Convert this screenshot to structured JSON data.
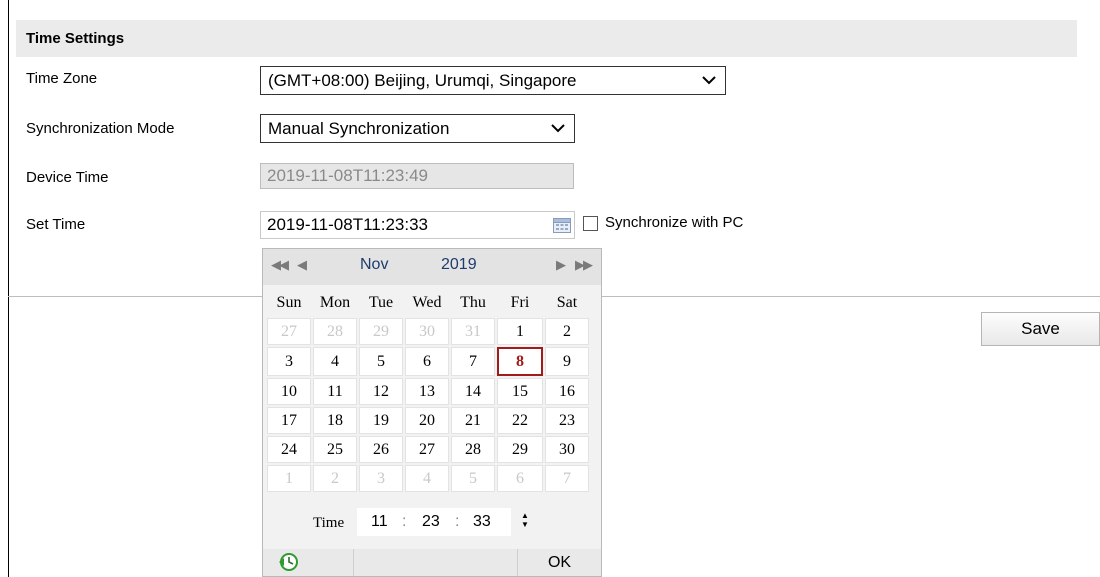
{
  "section": {
    "title": "Time Settings"
  },
  "fields": {
    "time_zone_label": "Time Zone",
    "time_zone_value": "(GMT+08:00) Beijing, Urumqi, Singapore",
    "sync_mode_label": "Synchronization Mode",
    "sync_mode_value": "Manual Synchronization",
    "device_time_label": "Device Time",
    "device_time_value": "2019-11-08T11:23:49",
    "set_time_label": "Set Time",
    "set_time_value": "2019-11-08T11:23:33",
    "sync_pc_label": "Synchronize with PC",
    "sync_pc_checked": false
  },
  "buttons": {
    "save": "Save",
    "ok": "OK"
  },
  "calendar": {
    "month": "Nov",
    "year": "2019",
    "weekdays": [
      "Sun",
      "Mon",
      "Tue",
      "Wed",
      "Thu",
      "Fri",
      "Sat"
    ],
    "weeks": [
      [
        "27",
        "28",
        "29",
        "30",
        "31",
        "1",
        "2"
      ],
      [
        "3",
        "4",
        "5",
        "6",
        "7",
        "8",
        "9"
      ],
      [
        "10",
        "11",
        "12",
        "13",
        "14",
        "15",
        "16"
      ],
      [
        "17",
        "18",
        "19",
        "20",
        "21",
        "22",
        "23"
      ],
      [
        "24",
        "25",
        "26",
        "27",
        "28",
        "29",
        "30"
      ],
      [
        "1",
        "2",
        "3",
        "4",
        "5",
        "6",
        "7"
      ]
    ],
    "selected_day": "8",
    "time_label": "Time",
    "hour": "11",
    "minute": "23",
    "second": "33"
  },
  "icons": {
    "dropdown": "chevron-down-icon",
    "calendar": "calendar-icon",
    "today": "clock-refresh-icon",
    "prev_year": "double-left-arrow-icon",
    "prev_month": "left-arrow-icon",
    "next_month": "right-arrow-icon",
    "next_year": "double-right-arrow-icon"
  },
  "colors": {
    "selected_day": "#a11b1b",
    "month_year": "#1f3b6d",
    "today_icon": "#2e9b2e"
  }
}
